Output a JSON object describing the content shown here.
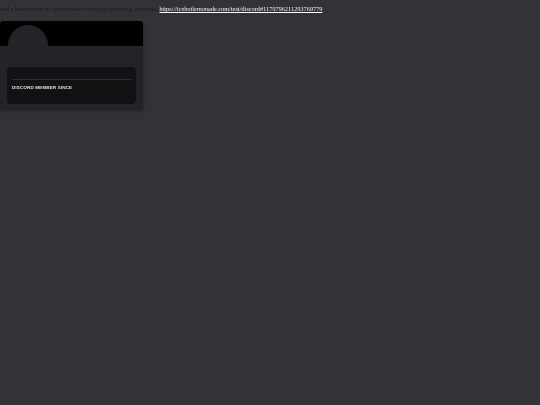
{
  "instructions": {
    "text": "add a hash to the url and reload if nothing's showing, example: ",
    "link_text": "https://icehotlemonade.com/test/discord#1179796211293769779"
  },
  "profile": {
    "member_since_label": "DISCORD MEMBER SINCE",
    "banner_color": "#000000",
    "card_color": "#232428"
  }
}
